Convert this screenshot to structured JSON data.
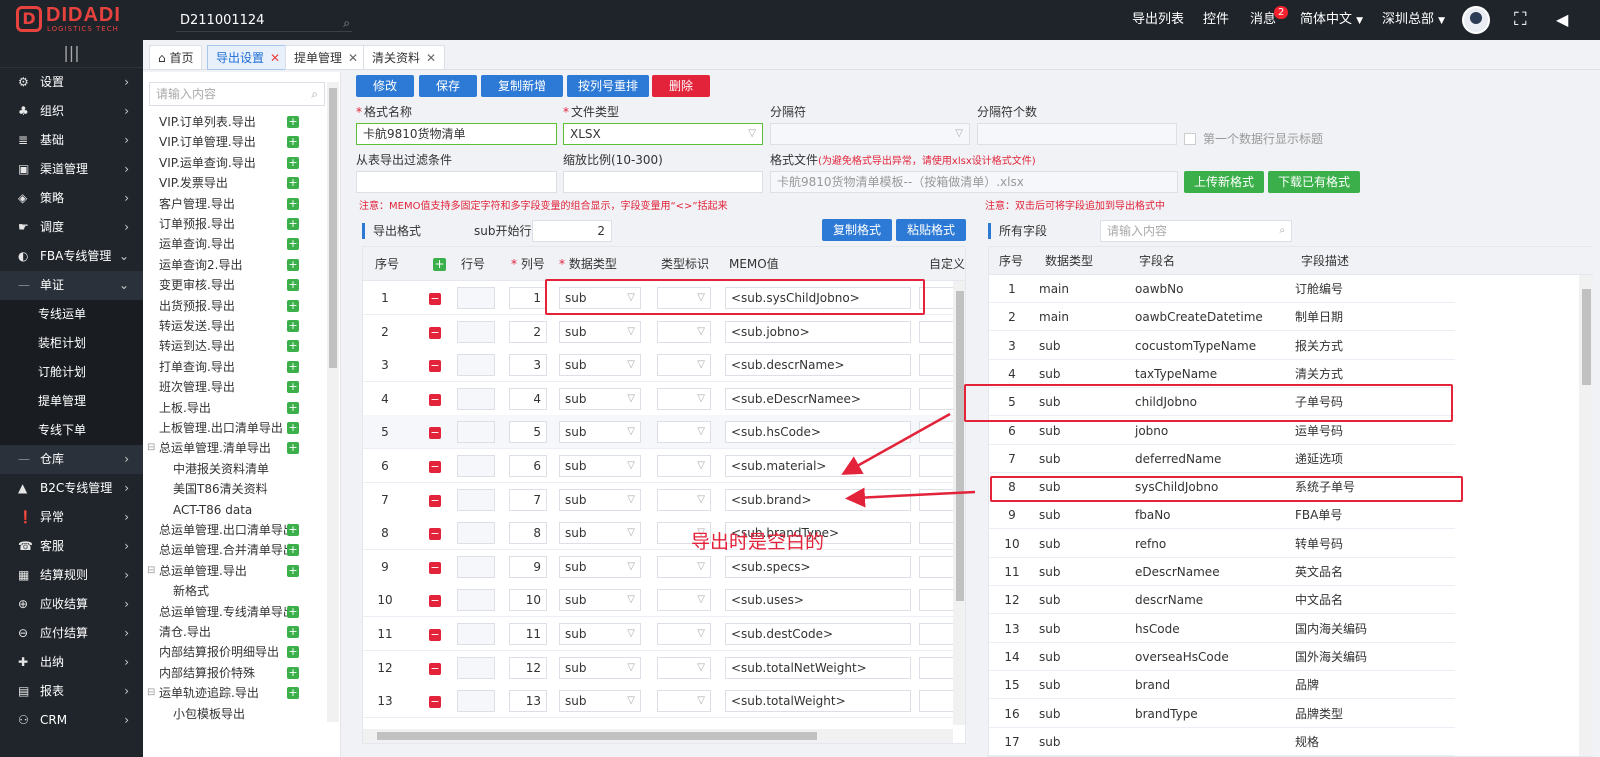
{
  "logo": {
    "name": "DIDADI",
    "sub": "LOGISTICS TECH"
  },
  "top_search": {
    "value": "D211001124"
  },
  "top_menu": {
    "export_list": "导出列表",
    "plugin": "控件",
    "messages": "消息",
    "messages_badge": "2",
    "language": "简体中文",
    "region": "深圳总部"
  },
  "sidebar": {
    "items": [
      {
        "label": "设置",
        "icon": "gear-icon",
        "glyph": "⚙"
      },
      {
        "label": "组织",
        "icon": "org-icon",
        "glyph": "♣"
      },
      {
        "label": "基础",
        "icon": "layers-icon",
        "glyph": "≣"
      },
      {
        "label": "渠道管理",
        "icon": "truck-icon",
        "glyph": "▣"
      },
      {
        "label": "策略",
        "icon": "compass-icon",
        "glyph": "◈"
      },
      {
        "label": "调度",
        "icon": "hand-icon",
        "glyph": "☛"
      },
      {
        "label": "FBA专线管理",
        "icon": "globe-icon",
        "glyph": "◐"
      },
      {
        "label": "单证",
        "icon": "doc-icon",
        "glyph": "—"
      },
      {
        "label": "仓库",
        "icon": "warehouse-icon",
        "glyph": "—"
      },
      {
        "label": "B2C专线管理",
        "icon": "box-icon",
        "glyph": "▲"
      },
      {
        "label": "异常",
        "icon": "alert-icon",
        "glyph": "❗"
      },
      {
        "label": "客服",
        "icon": "headset-icon",
        "glyph": "☎"
      },
      {
        "label": "结算规则",
        "icon": "calc-icon",
        "glyph": "▦"
      },
      {
        "label": "应收结算",
        "icon": "coin-icon",
        "glyph": "⊕"
      },
      {
        "label": "应付结算",
        "icon": "wallet-icon",
        "glyph": "⊖"
      },
      {
        "label": "出纳",
        "icon": "cashier-icon",
        "glyph": "✚"
      },
      {
        "label": "报表",
        "icon": "report-icon",
        "glyph": "▤"
      },
      {
        "label": "CRM",
        "icon": "crm-icon",
        "glyph": "⚇"
      }
    ],
    "subitems": [
      "专线运单",
      "装柜计划",
      "订舱计划",
      "提单管理",
      "专线下单"
    ]
  },
  "tabs": [
    {
      "label": "首页"
    },
    {
      "label": "导出设置"
    },
    {
      "label": "提单管理"
    },
    {
      "label": "清关资料"
    }
  ],
  "tree": {
    "search_placeholder": "请输入内容",
    "items": [
      {
        "label": "VIP.订单列表.导出",
        "plus": true,
        "indent": 0
      },
      {
        "label": "VIP.订单管理.导出",
        "plus": true,
        "indent": 0
      },
      {
        "label": "VIP.运单查询.导出",
        "plus": true,
        "indent": 0
      },
      {
        "label": "VIP.发票导出",
        "plus": true,
        "indent": 0
      },
      {
        "label": "客户管理.导出",
        "plus": true,
        "indent": 0
      },
      {
        "label": "订单预报.导出",
        "plus": true,
        "indent": 0
      },
      {
        "label": "运单查询.导出",
        "plus": true,
        "indent": 0
      },
      {
        "label": "运单查询2.导出",
        "plus": true,
        "indent": 0
      },
      {
        "label": "变更审核.导出",
        "plus": true,
        "indent": 0
      },
      {
        "label": "出货预报.导出",
        "plus": true,
        "indent": 0
      },
      {
        "label": "转运发送.导出",
        "plus": true,
        "indent": 0
      },
      {
        "label": "转运到达.导出",
        "plus": true,
        "indent": 0
      },
      {
        "label": "打单查询.导出",
        "plus": true,
        "indent": 0
      },
      {
        "label": "班次管理.导出",
        "plus": true,
        "indent": 0
      },
      {
        "label": "上板.导出",
        "plus": true,
        "indent": 0
      },
      {
        "label": "上板管理.出口清单导出",
        "plus": true,
        "indent": 0
      },
      {
        "label": "总运单管理.清单导出",
        "plus": true,
        "indent": 0,
        "toggle": true
      },
      {
        "label": "中港报关资料清单",
        "plus": false,
        "indent": 1
      },
      {
        "label": "美国T86清关资料",
        "plus": false,
        "indent": 1
      },
      {
        "label": "ACT-T86 data",
        "plus": false,
        "indent": 1
      },
      {
        "label": "总运单管理.出口清单导出",
        "plus": true,
        "indent": 0
      },
      {
        "label": "总运单管理.合并清单导出",
        "plus": true,
        "indent": 0
      },
      {
        "label": "总运单管理.导出",
        "plus": true,
        "indent": 0,
        "toggle": true
      },
      {
        "label": "新格式",
        "plus": false,
        "indent": 1
      },
      {
        "label": "总运单管理.专线清单导出",
        "plus": true,
        "indent": 0
      },
      {
        "label": "清仓.导出",
        "plus": true,
        "indent": 0
      },
      {
        "label": "内部结算报价明细导出",
        "plus": true,
        "indent": 0
      },
      {
        "label": "内部结算报价特殊",
        "plus": true,
        "indent": 0
      },
      {
        "label": "运单轨迹追踪.导出",
        "plus": true,
        "indent": 0,
        "toggle": true
      },
      {
        "label": "小包模板导出",
        "plus": false,
        "indent": 1
      }
    ]
  },
  "toolbar": {
    "modify": "修改",
    "save": "保存",
    "copy_new": "复制新增",
    "reorder": "按列号重排",
    "delete": "删除"
  },
  "form": {
    "format_name_label": "格式名称",
    "format_name_value": "卡航9810货物清单",
    "file_type_label": "文件类型",
    "file_type_value": "XLSX",
    "separator_label": "分隔符",
    "separator_count_label": "分隔符个数",
    "first_row_title_label": "第一个数据行显示标题",
    "filter_label": "从表导出过滤条件",
    "scale_label": "缩放比例(10-300)",
    "format_file_label": "格式文件",
    "format_file_note": "(为避免格式导出异常，请使用xlsx设计格式文件)",
    "format_file_value": "卡航9810货物清单模板--（按箱做清单）.xlsx",
    "upload_btn": "上传新格式",
    "download_btn": "下载已有格式"
  },
  "notices": {
    "left": "注意：MEMO值支持多固定字符和多字段变量的组合显示，字段变量用“<>”括起来",
    "right": "注意：双击后可将字段追加到导出格式中"
  },
  "export_section": {
    "title": "导出格式",
    "sub_start_label": "sub开始行",
    "sub_start_value": "2",
    "copy_btn": "复制格式",
    "paste_btn": "粘贴格式"
  },
  "export_table": {
    "headers": {
      "seq": "序号",
      "row_no": "行号",
      "col_no": "列号",
      "data_type": "数据类型",
      "type_flag": "类型标识",
      "memo": "MEMO值",
      "custom": "自定义编"
    },
    "rows": [
      {
        "seq": "1",
        "col": "1",
        "type": "sub",
        "memo": "<sub.sysChildJobno>"
      },
      {
        "seq": "2",
        "col": "2",
        "type": "sub",
        "memo": "<sub.jobno>"
      },
      {
        "seq": "3",
        "col": "3",
        "type": "sub",
        "memo": "<sub.descrName>"
      },
      {
        "seq": "4",
        "col": "4",
        "type": "sub",
        "memo": "<sub.eDescrNamee>"
      },
      {
        "seq": "5",
        "col": "5",
        "type": "sub",
        "memo": "<sub.hsCode>"
      },
      {
        "seq": "6",
        "col": "6",
        "type": "sub",
        "memo": "<sub.material>"
      },
      {
        "seq": "7",
        "col": "7",
        "type": "sub",
        "memo": "<sub.brand>"
      },
      {
        "seq": "8",
        "col": "8",
        "type": "sub",
        "memo": "<sub.brandType>"
      },
      {
        "seq": "9",
        "col": "9",
        "type": "sub",
        "memo": "<sub.specs>"
      },
      {
        "seq": "10",
        "col": "10",
        "type": "sub",
        "memo": "<sub.uses>"
      },
      {
        "seq": "11",
        "col": "11",
        "type": "sub",
        "memo": "<sub.destCode>"
      },
      {
        "seq": "12",
        "col": "12",
        "type": "sub",
        "memo": "<sub.totalNetWeight>"
      },
      {
        "seq": "13",
        "col": "13",
        "type": "sub",
        "memo": "<sub.totalWeight>"
      }
    ]
  },
  "fields_section": {
    "title": "所有字段",
    "search_placeholder": "请输入内容"
  },
  "fields_table": {
    "headers": {
      "seq": "序号",
      "data_type": "数据类型",
      "field_name": "字段名",
      "field_desc": "字段描述"
    },
    "rows": [
      {
        "seq": "1",
        "type": "main",
        "name": "oawbNo",
        "desc": "订舱编号"
      },
      {
        "seq": "2",
        "type": "main",
        "name": "oawbCreateDatetime",
        "desc": "制单日期"
      },
      {
        "seq": "3",
        "type": "sub",
        "name": "cocustomTypeName",
        "desc": "报关方式"
      },
      {
        "seq": "4",
        "type": "sub",
        "name": "taxTypeName",
        "desc": "清关方式"
      },
      {
        "seq": "5",
        "type": "sub",
        "name": "childJobno",
        "desc": "子单号码"
      },
      {
        "seq": "6",
        "type": "sub",
        "name": "jobno",
        "desc": "运单号码"
      },
      {
        "seq": "7",
        "type": "sub",
        "name": "deferredName",
        "desc": "递延选项"
      },
      {
        "seq": "8",
        "type": "sub",
        "name": "sysChildJobno",
        "desc": "系统子单号"
      },
      {
        "seq": "9",
        "type": "sub",
        "name": "fbaNo",
        "desc": "FBA单号"
      },
      {
        "seq": "10",
        "type": "sub",
        "name": "refno",
        "desc": "转单号码"
      },
      {
        "seq": "11",
        "type": "sub",
        "name": "eDescrNamee",
        "desc": "英文品名"
      },
      {
        "seq": "12",
        "type": "sub",
        "name": "descrName",
        "desc": "中文品名"
      },
      {
        "seq": "13",
        "type": "sub",
        "name": "hsCode",
        "desc": "国内海关编码"
      },
      {
        "seq": "14",
        "type": "sub",
        "name": "overseaHsCode",
        "desc": "国外海关编码"
      },
      {
        "seq": "15",
        "type": "sub",
        "name": "brand",
        "desc": "品牌"
      },
      {
        "seq": "16",
        "type": "sub",
        "name": "brandType",
        "desc": "品牌类型"
      },
      {
        "seq": "17",
        "type": "sub",
        "name": "",
        "desc": "规格"
      }
    ]
  },
  "annotation": {
    "text": "导出时是空白的"
  },
  "colors": {
    "accent": "#2d7ad6",
    "danger": "#e2233a",
    "success": "#3bb04a",
    "sidebar": "#20252c"
  }
}
